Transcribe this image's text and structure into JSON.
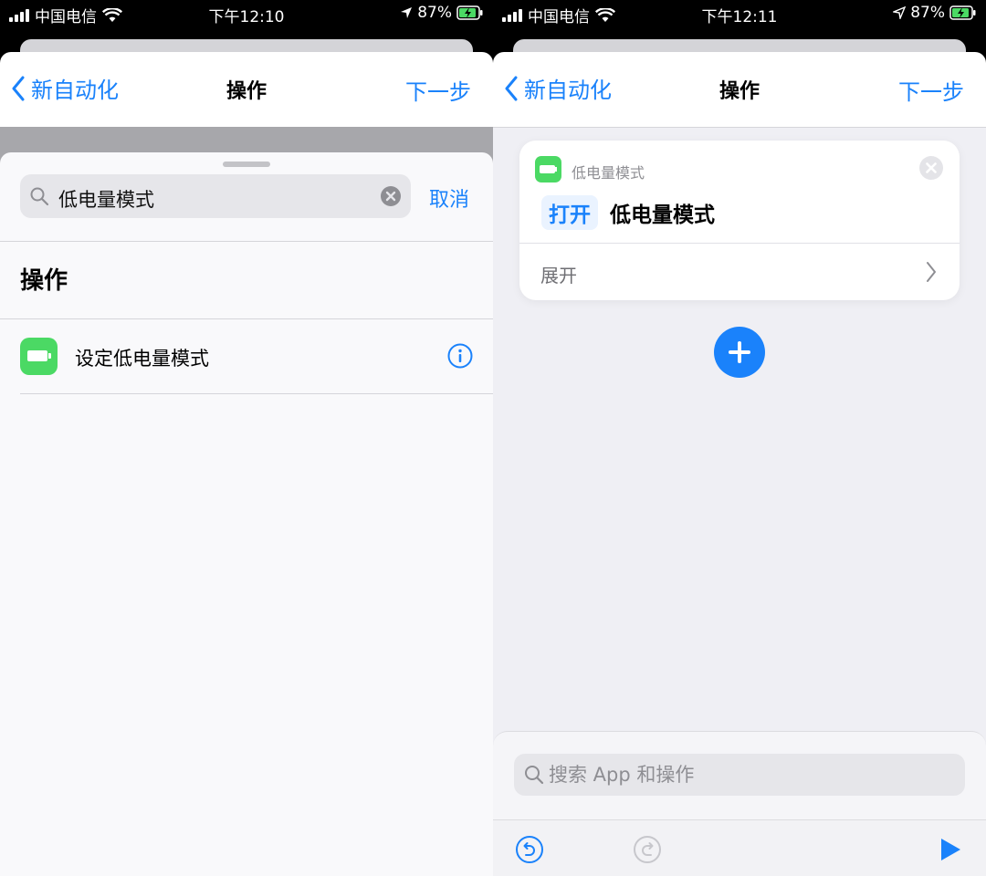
{
  "left": {
    "status": {
      "carrier": "中国电信",
      "time": "下午12:10",
      "battery": "87%"
    },
    "nav": {
      "back_label": "新自动化",
      "title": "操作",
      "next_label": "下一步"
    },
    "search": {
      "value": "低电量模式"
    },
    "cancel_label": "取消",
    "section_title": "操作",
    "results": [
      {
        "label": "设定低电量模式"
      }
    ]
  },
  "right": {
    "status": {
      "carrier": "中国电信",
      "time": "下午12:11",
      "battery": "87%"
    },
    "nav": {
      "back_label": "新自动化",
      "title": "操作",
      "next_label": "下一步"
    },
    "card": {
      "app_name": "低电量模式",
      "action_token": "打开",
      "param": "低电量模式",
      "expand_label": "展开"
    },
    "search": {
      "placeholder": "搜索 App 和操作"
    }
  },
  "colors": {
    "accent": "#1a82fb",
    "battery_green": "#4bd964"
  },
  "icons": [
    "signal-icon",
    "wifi-icon",
    "location-icon",
    "battery-charging-icon",
    "chevron-left-icon",
    "search-icon",
    "clear-icon",
    "battery-app-icon",
    "info-icon",
    "close-icon",
    "chevron-right-icon",
    "plus-icon",
    "undo-icon",
    "redo-icon",
    "play-icon"
  ]
}
